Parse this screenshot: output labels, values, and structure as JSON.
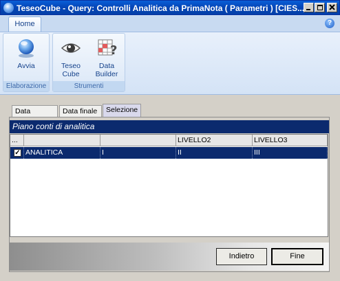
{
  "window": {
    "title": "TeseoCube - Query: Controlli Analitica da PrimaNota ( Parametri ) [CIES..."
  },
  "ribbon": {
    "tab": "Home",
    "help": "?",
    "groups": [
      {
        "label": "Elaborazione",
        "buttons": [
          {
            "label": "Avvia",
            "icon": "globe-icon"
          }
        ]
      },
      {
        "label": "Strumenti",
        "buttons": [
          {
            "label": "Teseo",
            "label2": "Cube",
            "icon": "eye-icon"
          },
          {
            "label": "Data",
            "label2": "Builder",
            "icon": "grid-question-icon"
          }
        ]
      }
    ]
  },
  "tabs": [
    "Data iniziale",
    "Data finale",
    "Selezione"
  ],
  "active_tab": "Selezione",
  "grid": {
    "caption": "Piano conti di analitica",
    "columns": [
      "...",
      "",
      "",
      "LIVELLO2",
      "LIVELLO3"
    ],
    "rows": [
      {
        "checked": true,
        "name": "ANALITICA",
        "col2": "I",
        "livello2": "II",
        "livello3": "III"
      }
    ]
  },
  "buttons": {
    "back": "Indietro",
    "finish": "Fine"
  },
  "colors": {
    "title_blue": "#0446b8",
    "header_navy": "#0b2a6e",
    "ribbon_text": "#15428b"
  }
}
